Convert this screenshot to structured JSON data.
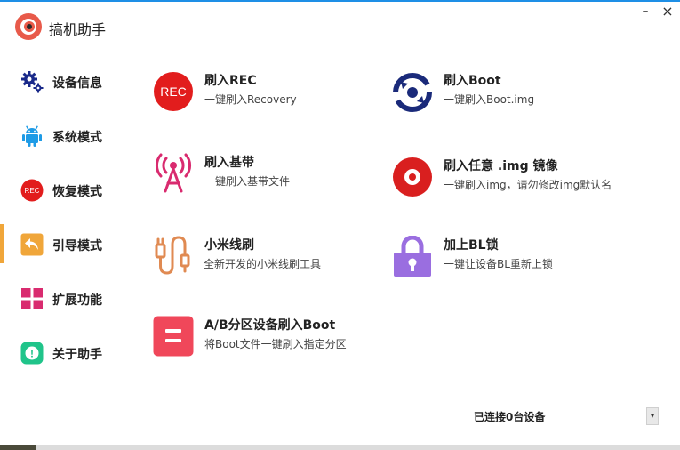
{
  "app": {
    "title": "搞机助手"
  },
  "window": {
    "minimize_glyph": "–",
    "close_glyph": "×"
  },
  "sidebar": {
    "active_index": 3,
    "items": [
      {
        "label": "设备信息",
        "icon": "gears-icon",
        "color": "#1a2a8a"
      },
      {
        "label": "系统模式",
        "icon": "android-icon",
        "color": "#1e9be6"
      },
      {
        "label": "恢复模式",
        "icon": "rec-icon",
        "color": "#e21d1d",
        "icon_text": "REC"
      },
      {
        "label": "引导模式",
        "icon": "back-arrow-icon",
        "color": "#f0a63a"
      },
      {
        "label": "扩展功能",
        "icon": "grid-icon",
        "color": "#d92b6f"
      },
      {
        "label": "关于助手",
        "icon": "info-icon",
        "color": "#20c48a",
        "icon_text": "!"
      }
    ]
  },
  "features": [
    {
      "title": "刷入REC",
      "desc": "一键刷入Recovery",
      "icon": "rec-icon",
      "icon_text": "REC",
      "color": "#e21d1d"
    },
    {
      "title": "刷入Boot",
      "desc": "一键刷入Boot.img",
      "icon": "boot-icon",
      "color": "#1a2a7a"
    },
    {
      "title": "刷入基带",
      "desc": "一键刷入基带文件",
      "icon": "antenna-icon",
      "color": "#d92b6f"
    },
    {
      "title": "刷入任意 .img 镜像",
      "desc": "一键刷入img，请勿修改img默认名",
      "icon": "disc-icon",
      "color": "#d91f1f"
    },
    {
      "title": "小米线刷",
      "desc": "全新开发的小米线刷工具",
      "icon": "usb-cable-icon",
      "color": "#e08a52"
    },
    {
      "title": "加上BL锁",
      "desc": "一键让设备BL重新上锁",
      "icon": "lock-icon",
      "color": "#9a6ee0"
    },
    {
      "title": "A/B分区设备刷入Boot",
      "desc": "将Boot文件一键刷入指定分区",
      "icon": "ab-partition-icon",
      "color": "#f0475a"
    }
  ],
  "status": {
    "text": "已连接0台设备",
    "dropdown_glyph": "▾"
  }
}
